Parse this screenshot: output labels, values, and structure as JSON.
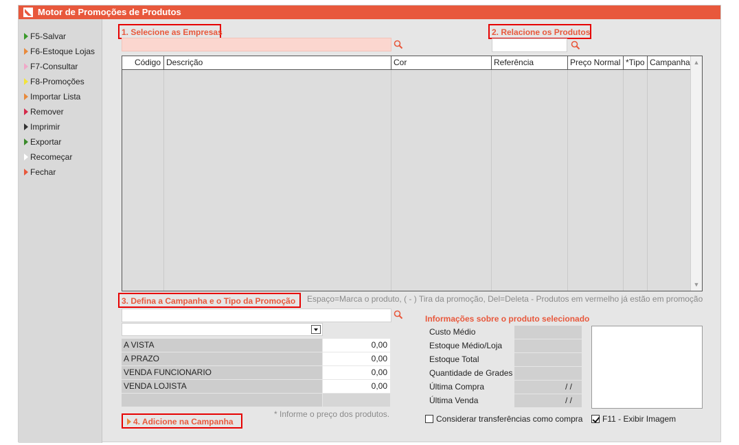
{
  "window": {
    "title": "Motor de Promoções de Produtos"
  },
  "sidebar": {
    "items": [
      {
        "label": "F5-Salvar",
        "color": "#3a9a2a"
      },
      {
        "label": "F6-Estoque Lojas",
        "color": "#e88a3c"
      },
      {
        "label": "F7-Consultar",
        "color": "#f0a8c8"
      },
      {
        "label": "F8-Promoções",
        "color": "#f2e43a"
      },
      {
        "label": "Importar Lista",
        "color": "#e88a3c"
      },
      {
        "label": "Remover",
        "color": "#d42a4a"
      },
      {
        "label": "Imprimir",
        "color": "#333333"
      },
      {
        "label": "Exportar",
        "color": "#3a8a2a"
      },
      {
        "label": "Recomeçar",
        "color": "#ffffff"
      },
      {
        "label": "Fechar",
        "color": "#e8583c"
      }
    ]
  },
  "steps": {
    "step1": "1. Selecione as Empresas",
    "step2": "2. Relacione os Produtos",
    "step3": "3. Defina a Campanha e o Tipo da Promoção",
    "step4": "4. Adicione na Campanha"
  },
  "grid": {
    "columns": [
      "Código",
      "Descrição",
      "Cor",
      "Referência",
      "Preço Normal",
      "*Tipo",
      "Campanha"
    ],
    "rows": []
  },
  "hints": {
    "keys": "Espaço=Marca o produto, ( - ) Tira da promoção, Del=Deleta - Produtos em vermelho já estão em promoção",
    "prices": "* Informe o preço dos produtos."
  },
  "prices": [
    {
      "label": "A VISTA",
      "value": "0,00"
    },
    {
      "label": "A PRAZO",
      "value": "0,00"
    },
    {
      "label": "VENDA FUNCIONARIO",
      "value": "0,00"
    },
    {
      "label": "VENDA LOJISTA",
      "value": "0,00"
    }
  ],
  "info": {
    "title": "Informações sobre o produto selecionado",
    "rows": [
      {
        "label": "Custo Médio",
        "value": ""
      },
      {
        "label": "Estoque Médio/Loja",
        "value": ""
      },
      {
        "label": "Estoque Total",
        "value": ""
      },
      {
        "label": "Quantidade de Grades",
        "value": ""
      },
      {
        "label": "Última Compra",
        "value": "/ /"
      },
      {
        "label": "Última Venda",
        "value": "/ /"
      }
    ]
  },
  "options": {
    "transfer_label": "Considerar transferências como compra",
    "transfer_checked": false,
    "image_label": "F11 - Exibir Imagem",
    "image_checked": true
  },
  "colors": {
    "accent": "#e8583c",
    "highlight_border": "#e60000",
    "company_field": "#fbd6cf"
  }
}
